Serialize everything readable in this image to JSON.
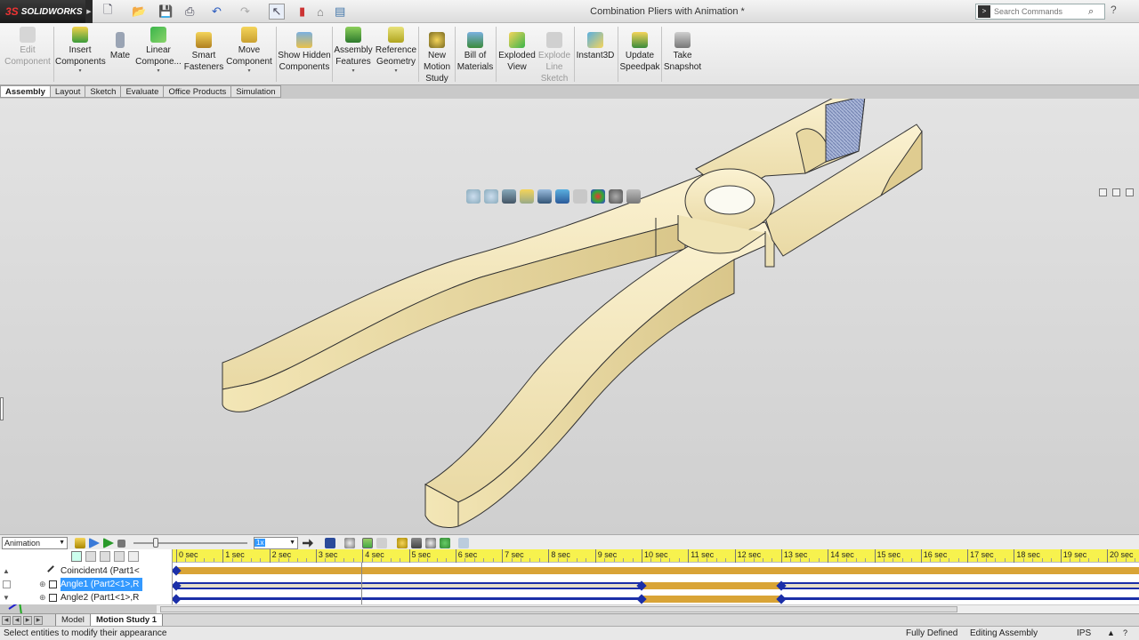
{
  "app": {
    "brand": "SOLIDWORKS",
    "brand_ds": "3S"
  },
  "title": {
    "document": "Combination Pliers with Animation *"
  },
  "search": {
    "placeholder": "Search Commands"
  },
  "ribbon": {
    "buttons": [
      {
        "label": "Edit Component",
        "icon": "edit-component-icon",
        "enabled": false
      },
      {
        "label": "Insert Components",
        "icon": "insert-components-icon",
        "enabled": true
      },
      {
        "label": "Mate",
        "icon": "mate-paperclip-icon",
        "enabled": true
      },
      {
        "label": "Linear Compone...",
        "icon": "linear-pattern-icon",
        "enabled": true
      },
      {
        "label": "Smart Fasteners",
        "icon": "smart-fasteners-icon",
        "enabled": true
      },
      {
        "label": "Move Component",
        "icon": "move-component-icon",
        "enabled": true
      },
      {
        "label": "Show Hidden Components",
        "icon": "show-hidden-icon",
        "enabled": true
      },
      {
        "label": "Assembly Features",
        "icon": "assembly-features-icon",
        "enabled": true
      },
      {
        "label": "Reference Geometry",
        "icon": "reference-geometry-icon",
        "enabled": true
      },
      {
        "label": "New Motion Study",
        "icon": "motion-study-icon",
        "enabled": true
      },
      {
        "label": "Bill of Materials",
        "icon": "bom-icon",
        "enabled": true
      },
      {
        "label": "Exploded View",
        "icon": "exploded-view-icon",
        "enabled": true
      },
      {
        "label": "Explode Line Sketch",
        "icon": "explode-line-icon",
        "enabled": false
      },
      {
        "label": "Instant3D",
        "icon": "instant3d-icon",
        "enabled": true
      },
      {
        "label": "Update Speedpak",
        "icon": "speedpak-icon",
        "enabled": true
      },
      {
        "label": "Take Snapshot",
        "icon": "snapshot-icon",
        "enabled": true
      }
    ]
  },
  "tabs": [
    "Assembly",
    "Layout",
    "Sketch",
    "Evaluate",
    "Office Products",
    "Simulation"
  ],
  "motion": {
    "study_type": "Animation",
    "speed": "1x",
    "ruler": [
      "0 sec",
      "1 sec",
      "2 sec",
      "3 sec",
      "4 sec",
      "5 sec",
      "6 sec",
      "7 sec",
      "8 sec",
      "9 sec",
      "10 sec",
      "11 sec",
      "12 sec",
      "13 sec",
      "14 sec",
      "15 sec",
      "16 sec",
      "17 sec",
      "18 sec",
      "19 sec",
      "20 sec"
    ],
    "rows": [
      {
        "label": "Coincident4 (Part1<",
        "selected": false
      },
      {
        "label": "Angle1 (Part2<1>,R",
        "selected": true
      },
      {
        "label": "Angle2 (Part1<1>,R",
        "selected": false
      }
    ]
  },
  "bottom_tabs": [
    "Model",
    "Motion Study 1"
  ],
  "status": {
    "message": "Select entities to modify their appearance",
    "state": "Fully Defined",
    "mode": "Editing Assembly",
    "units": "IPS"
  },
  "colors": {
    "part": "#f6e9bf",
    "timeline_bar": "#d9a436",
    "key": "#1b2fa8",
    "ruler": "#f7f24e",
    "selection": "#3399ff"
  }
}
